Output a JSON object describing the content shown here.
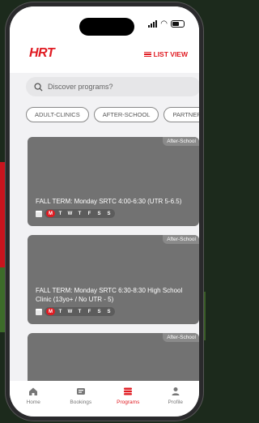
{
  "status_bar": {
    "time": ""
  },
  "header": {
    "logo_text": "HRT",
    "list_view_label": "LIST VIEW"
  },
  "search": {
    "placeholder": "Discover programs?"
  },
  "filters": [
    "ADULT-CLINICS",
    "AFTER-SCHOOL",
    "PARTNER"
  ],
  "cards": [
    {
      "badge": "After-School",
      "title": "FALL TERM: Monday SRTC 4:00-6:30 (UTR 5-6.5)",
      "days": [
        "M",
        "T",
        "W",
        "T",
        "F",
        "S",
        "S"
      ],
      "active_day_index": 0
    },
    {
      "badge": "After-School",
      "title": "FALL TERM: Monday SRTC 6:30-8:30 High School Clinic (13yo+ / No UTR - 5)",
      "days": [
        "M",
        "T",
        "W",
        "T",
        "F",
        "S",
        "S"
      ],
      "active_day_index": 0
    },
    {
      "badge": "After-School",
      "title": "",
      "days": [],
      "active_day_index": -1
    }
  ],
  "tabbar": {
    "items": [
      {
        "label": "Home",
        "icon": "home-icon"
      },
      {
        "label": "Bookings",
        "icon": "bookings-icon"
      },
      {
        "label": "Programs",
        "icon": "programs-icon"
      },
      {
        "label": "Profile",
        "icon": "profile-icon"
      }
    ],
    "active_index": 2
  },
  "colors": {
    "accent": "#e01b22",
    "card_bg": "#727272",
    "screen_bg": "#f2f2f4"
  }
}
